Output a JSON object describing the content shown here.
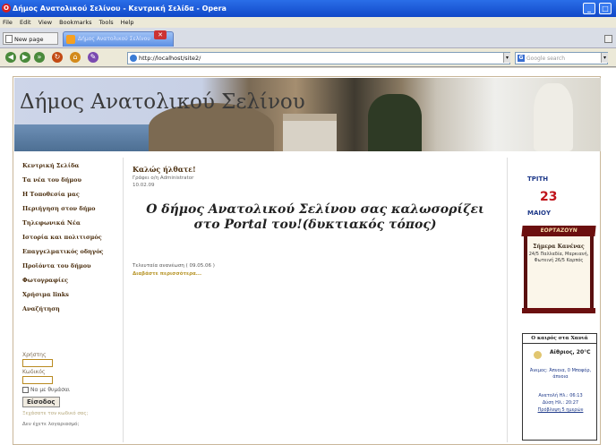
{
  "window": {
    "title": "Δήμος Ανατολικού Σελίνου - Κεντρική Σελίδα - Opera"
  },
  "menubar": [
    "File",
    "Edit",
    "View",
    "Bookmarks",
    "Tools",
    "Help"
  ],
  "tabs": {
    "new_page": "New page",
    "active_tab": "Δήμος Ανατολικού Σελίνου"
  },
  "toolbar": {
    "address": "http://localhost/site2/",
    "search_placeholder": "Google search"
  },
  "site": {
    "title": "Δήμος Ανατολικού Σελίνου"
  },
  "nav": [
    "Κεντρική Σελίδα",
    "Τα νέα του δήμου",
    "Η Τοποθεσία μας",
    "Περιήγηση στον δήμο",
    "Τηλεφωνικά Νέα",
    "Ιστορία και πολιτισμός",
    "Επαγγελματικός οδηγός",
    "Προϊόντα του δήμου",
    "Φωτογραφίες",
    "Χρήσιμα links",
    "Αναζήτηση"
  ],
  "login": {
    "username_label": "Χρήστης",
    "password_label": "Κωδικός",
    "remember": "Να με θυμάσαι",
    "submit": "Είσοδος",
    "forgot": "Ξεχάσατε τον κωδικό σας;",
    "no_account": "Δεν έχετε λογαριασμό;"
  },
  "article": {
    "title": "Καλώς ήλθατε!",
    "author": "Γράφει ο/η Administrator",
    "date": "10.02.09",
    "headline": "Ο δήμος Ανατολικού Σελίνου σας καλωσορίζει στο Portal του!(δυκτιακός τόπος)",
    "modified": "Τελευταία ανανέωση ( 09.05.06 )",
    "read_more": "Διαβάστε περισσότερα..."
  },
  "calendar": {
    "day_name": "ΤΡΙΤΗ",
    "day_num": "23",
    "month": "ΜΑΙΟΥ"
  },
  "feasts": {
    "title": "ΕΟΡΤΑΖΟΥΝ",
    "today": "Σήμερα Κανένας",
    "list": "24/5 Παλλαδία, Μαρκιανή, Φωτεινή 26/5 Καρπός"
  },
  "weather": {
    "title": "Ο καιρός στα Χανιά",
    "condition": "Αίθριος, 20°C",
    "wind": "Άνεμος: Άπνοια, 0 Μποφόρ, άπνοια",
    "sunrise": "Ανατολή Ηλ.: 06:13",
    "sunset": "Δύση Ηλ.: 20:27",
    "more": "Πρόβλεψη 5 ημερών"
  },
  "colors": {
    "accent_title": "#1148c8",
    "nav_text": "#4a2d0d",
    "calendar_day": "#c0141b",
    "scroll": "#6b0f0f"
  }
}
